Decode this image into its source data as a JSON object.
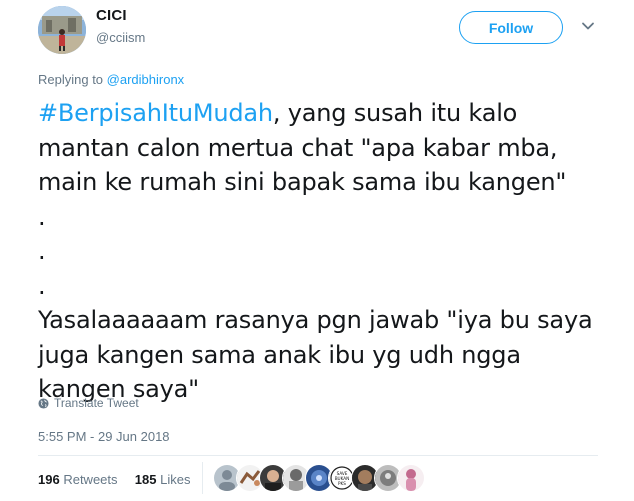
{
  "user": {
    "display_name": "CICI",
    "handle": "@cciism"
  },
  "follow_label": "Follow",
  "replying": {
    "prefix": "Replying to",
    "to": "@ardibhironx"
  },
  "tweet": {
    "hashtag": "#BerpisahItuMudah",
    "line1_rest": ", yang susah itu kalo",
    "line2": "mantan calon mertua chat \"apa kabar mba,",
    "line3": "main ke rumah sini bapak sama ibu kangen\"",
    "dot1": ".",
    "dot2": ".",
    "dot3": ".",
    "line4": "Yasalaaaaaam rasanya pgn jawab \"iya bu saya",
    "line5": "juga kangen sama anak ibu yg udh ngga",
    "line6": "kangen saya\""
  },
  "translate_label": "Translate Tweet",
  "timestamp": "5:55 PM - 29 Jun 2018",
  "stats": {
    "retweets_count": "196",
    "retweets_label": "Retweets",
    "likes_count": "185",
    "likes_label": "Likes"
  },
  "liker_avatar_badge": "SAVE BUKAN PKS",
  "colors": {
    "link_blue": "#1da1f2",
    "secondary_gray": "#657786",
    "text_dark": "#14171a"
  }
}
